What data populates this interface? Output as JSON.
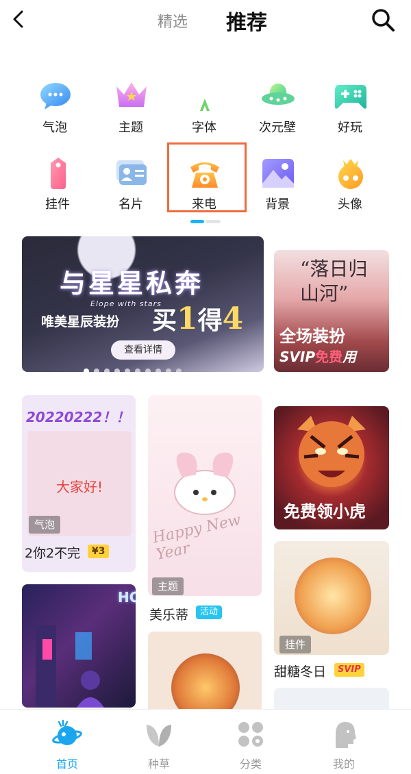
{
  "header": {
    "tab_featured": "精选",
    "tab_recommend": "推荐"
  },
  "categories": [
    {
      "label": "气泡",
      "icon": "chat-bubble-icon"
    },
    {
      "label": "主题",
      "icon": "crown-icon"
    },
    {
      "label": "字体",
      "icon": "font-icon"
    },
    {
      "label": "次元壁",
      "icon": "ufo-icon"
    },
    {
      "label": "好玩",
      "icon": "gamepad-icon"
    },
    {
      "label": "挂件",
      "icon": "pendant-tag-icon"
    },
    {
      "label": "名片",
      "icon": "name-card-icon"
    },
    {
      "label": "来电",
      "icon": "telephone-icon"
    },
    {
      "label": "背景",
      "icon": "picture-icon"
    },
    {
      "label": "头像",
      "icon": "avatar-crown-icon"
    }
  ],
  "banner": {
    "title": "与星星私奔",
    "subtitle_en": "Elope with stars",
    "subtitle": "唯美星辰装扮",
    "promo_a": "买",
    "promo_b": "1",
    "promo_c": "得",
    "promo_d": "4",
    "button": "查看详情",
    "dot_count": 10,
    "active_dot": 0
  },
  "side_card": {
    "quote": "“落日归山河”",
    "line1": "全场装扮",
    "line2_a": "SVIP",
    "line2_b": "免费",
    "line2_c": "用"
  },
  "cards": {
    "c1": {
      "date": "20220222！！",
      "greeting": "大家好!",
      "tag": "气泡",
      "title": "2你2不完",
      "price": "¥3"
    },
    "c2": {
      "art_text": "Happy New Year",
      "tag": "主题",
      "title": "美乐蒂",
      "badge": "活动"
    },
    "c3": {
      "art_text": "免费领小虎"
    },
    "c4": {
      "tag": "挂件",
      "title": "甜糖冬日",
      "badge": "SVIP"
    },
    "c5": {
      "sign": "HOTEL"
    }
  },
  "nav": [
    {
      "label": "首页",
      "icon": "planet-home-icon",
      "active": true
    },
    {
      "label": "种草",
      "icon": "leaf-icon",
      "active": false
    },
    {
      "label": "分类",
      "icon": "category-grid-icon",
      "active": false
    },
    {
      "label": "我的",
      "icon": "profile-head-icon",
      "active": false
    }
  ],
  "colors": {
    "accent": "#1aa6ee",
    "highlight": "#ef6b3e",
    "price_bg": "#ffd23c"
  }
}
